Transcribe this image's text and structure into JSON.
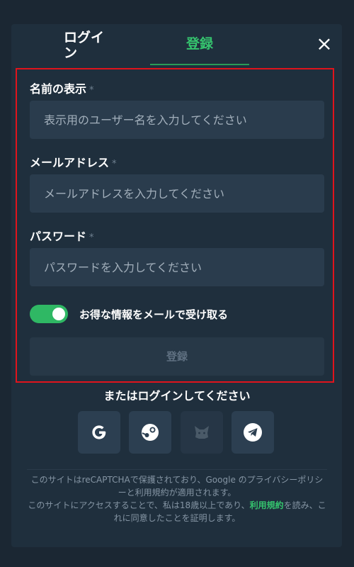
{
  "tabs": {
    "login": "ログイン",
    "register": "登録"
  },
  "close_icon": "×",
  "form": {
    "display_name_label": "名前の表示",
    "display_name_placeholder": "表示用のユーザー名を入力してください",
    "email_label": "メールアドレス",
    "email_placeholder": "メールアドレスを入力してください",
    "password_label": "パスワード",
    "password_placeholder": "パスワードを入力してください",
    "required_mark": "*",
    "newsletter_label": "お得な情報をメールで受け取る",
    "newsletter_on": true,
    "submit_label": "登録"
  },
  "social": {
    "or_text": "またはログインしてください",
    "providers": [
      "google-icon",
      "steam-icon",
      "metamask-icon",
      "telegram-icon"
    ]
  },
  "legal": {
    "line1": "このサイトはreCAPTCHAで保護されており、Google のプライバシーポリシーと利用規約が適用されます。",
    "line2_pre": "このサイトにアクセスすることで、私は18歳以上であり、",
    "terms_link": "利用規約",
    "line2_post": "を読み、これに同意したことを証明します。"
  },
  "colors": {
    "accent": "#35c46e",
    "background": "#1b2733",
    "panel": "#1f2f3d",
    "input": "#2a3c4d",
    "highlight_border": "#e0141c"
  }
}
